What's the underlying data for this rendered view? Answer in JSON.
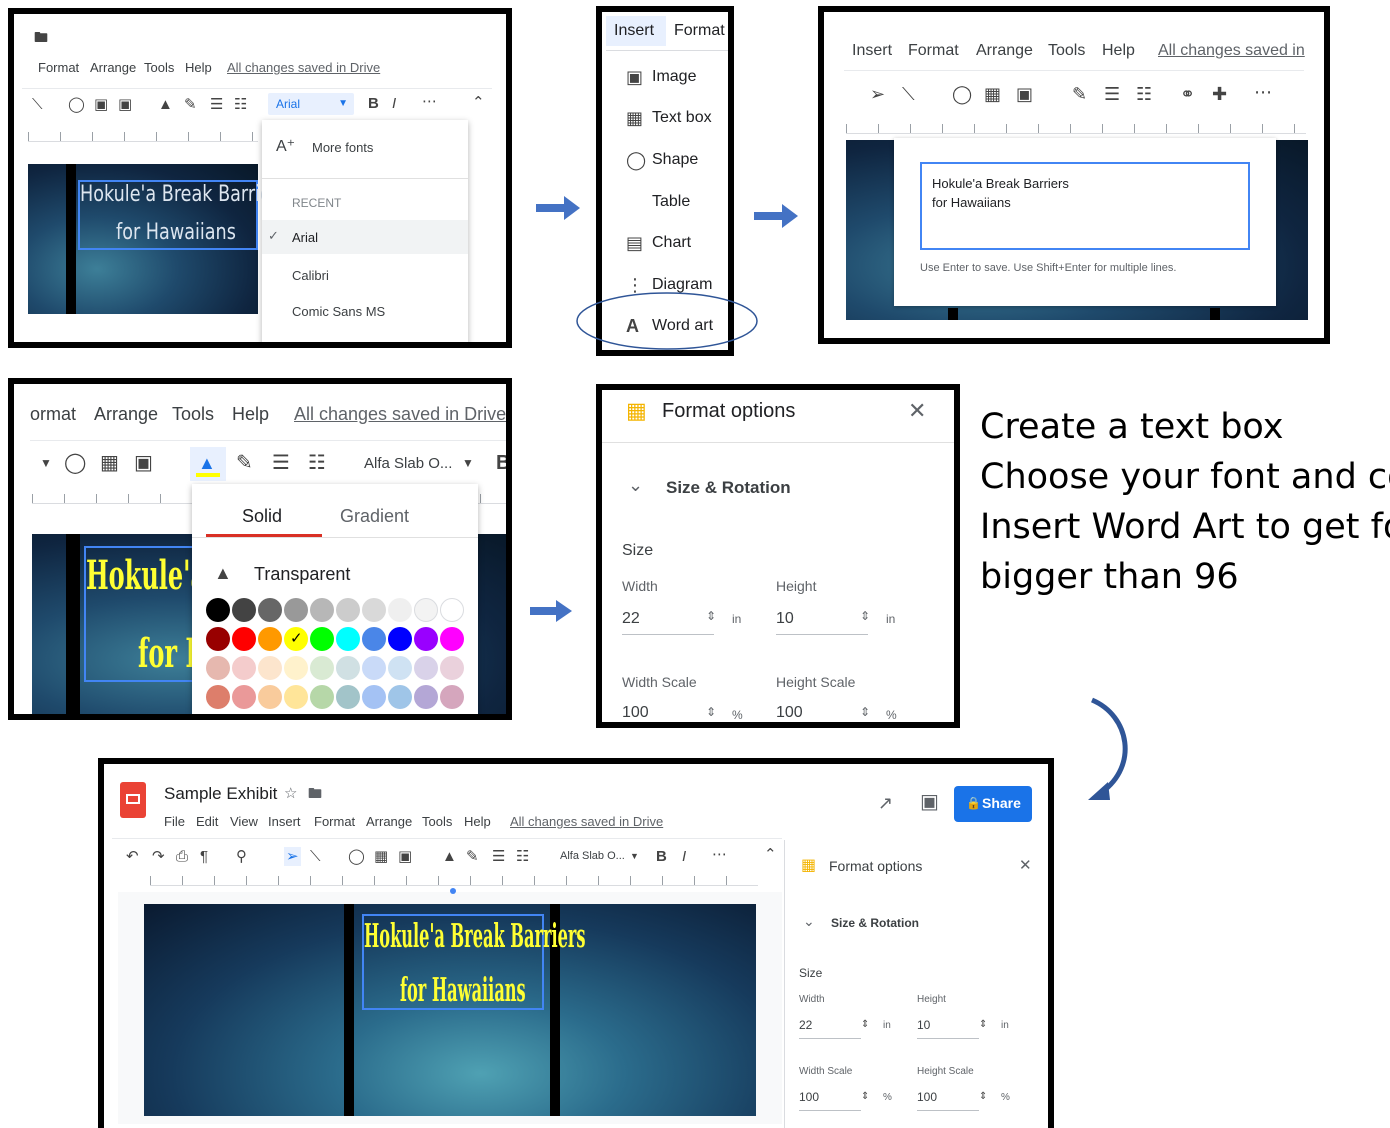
{
  "panel1": {
    "menu": [
      "Format",
      "Arrange",
      "Tools",
      "Help"
    ],
    "saved": "All changes saved in Drive",
    "font_select": "Arial",
    "slide_text": [
      "Hokule'a Break Barriers",
      "for Hawaiians"
    ],
    "dropdown": {
      "more_fonts": "More fonts",
      "recent_heading": "RECENT",
      "fonts": [
        "Arial",
        "Calibri",
        "Comic Sans MS"
      ]
    }
  },
  "panel2": {
    "tabs": [
      "Insert",
      "Format"
    ],
    "items": [
      "Image",
      "Text box",
      "Shape",
      "Table",
      "Chart",
      "Diagram",
      "Word art"
    ]
  },
  "panel3": {
    "menu": [
      "Insert",
      "Format",
      "Arrange",
      "Tools",
      "Help"
    ],
    "saved": "All changes saved in",
    "text_lines": [
      "Hokule'a Break Barriers",
      "for Hawaiians"
    ],
    "hint": "Use Enter to save. Use Shift+Enter for multiple lines."
  },
  "panel4": {
    "menu": [
      "ormat",
      "Arrange",
      "Tools",
      "Help"
    ],
    "saved": "All changes saved in Drive",
    "font_select": "Alfa Slab O...",
    "tabs": [
      "Solid",
      "Gradient"
    ],
    "transparent": "Transparent",
    "slide_text": [
      "Hokule'a B",
      "for H"
    ],
    "colors": {
      "row1": [
        "#000000",
        "#434343",
        "#666666",
        "#999999",
        "#b7b7b7",
        "#cccccc",
        "#d9d9d9",
        "#efefef",
        "#f3f3f3",
        "#ffffff"
      ],
      "row2": [
        "#980000",
        "#ff0000",
        "#ff9900",
        "#ffff00",
        "#00ff00",
        "#00ffff",
        "#4a86e8",
        "#0000ff",
        "#9900ff",
        "#ff00ff"
      ],
      "row3": [
        "#e6b8af",
        "#f4cccc",
        "#fce5cd",
        "#fff2cc",
        "#d9ead3",
        "#d0e0e3",
        "#c9daf8",
        "#cfe2f3",
        "#d9d2e9",
        "#ead1dc"
      ],
      "row4": [
        "#dd7e6b",
        "#ea9999",
        "#f9cb9c",
        "#ffe599",
        "#b6d7a8",
        "#a2c4c9",
        "#a4c2f4",
        "#9fc5e8",
        "#b4a7d6",
        "#d5a6bd"
      ]
    },
    "check_mark": "✓",
    "accent": "#ffff00"
  },
  "panel5": {
    "title": "Format options",
    "section": "Size & Rotation",
    "size_heading": "Size",
    "width_label": "Width",
    "height_label": "Height",
    "width_value": "22",
    "height_value": "10",
    "unit": "in",
    "width_scale_label": "Width Scale",
    "height_scale_label": "Height Scale",
    "width_scale_value": "100",
    "height_scale_value": "100",
    "pct": "%"
  },
  "instructions": [
    "Create a text box",
    "Choose your font and color",
    "Insert Word Art to get font",
    "bigger than 96"
  ],
  "panel6": {
    "doc_title": "Sample Exhibit",
    "menu": [
      "File",
      "Edit",
      "View",
      "Insert",
      "Format",
      "Arrange",
      "Tools",
      "Help"
    ],
    "saved": "All changes saved in Drive",
    "share": "Share",
    "font_select": "Alfa Slab O...",
    "slide_text": [
      "Hokule'a Break Barriers",
      "for Hawaiians"
    ],
    "fo_title": "Format options",
    "fo_section": "Size & Rotation",
    "size_heading": "Size",
    "width_label": "Width",
    "height_label": "Height",
    "width_value": "22",
    "height_value": "10",
    "unit": "in",
    "width_scale_label": "Width Scale",
    "height_scale_label": "Height Scale",
    "width_scale_value": "100",
    "height_scale_value": "100",
    "pct": "%"
  },
  "colors": {
    "arrow": "#4472c4",
    "selection": "#4285f4",
    "wordart": "#ffff33",
    "share_bg": "#1a73e8",
    "slides_red": "#ea4335",
    "format_icon": "#f4b400"
  }
}
